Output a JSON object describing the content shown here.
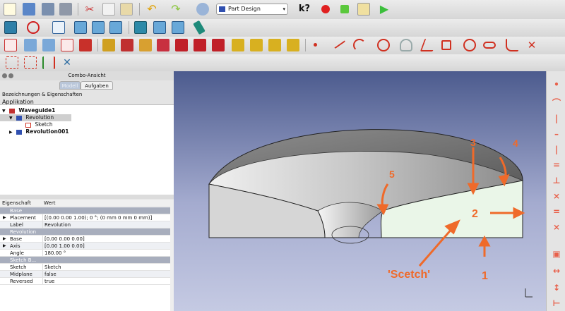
{
  "toolbar": {
    "workbench_label": "Part Design",
    "icons_row1": [
      "new-file",
      "open-file",
      "save-file",
      "save-as",
      "cut",
      "copy",
      "paste",
      "undo",
      "redo",
      "refresh",
      "workbench-selector",
      "whats-this",
      "record-macro",
      "stop-macro",
      "macro-editor",
      "run-macro"
    ],
    "icons_row2": [
      "fit-all",
      "draw-style",
      "axonometric",
      "front",
      "top",
      "right",
      "rear",
      "bottom",
      "left",
      "measure"
    ],
    "icons_row3": [
      "sketch",
      "pad-point",
      "validate",
      "sketch-map",
      "sketch-view",
      "pad",
      "pocket",
      "revolution",
      "groove",
      "fillet",
      "chamfer",
      "draft",
      "mirrored",
      "linear-pattern",
      "polar-pattern",
      "scaled",
      "multi-transform",
      "point",
      "line",
      "arc",
      "circle",
      "conic",
      "polyline",
      "rectangle",
      "polygon",
      "slot",
      "fillet-sketch",
      "trim"
    ],
    "icons_row4": [
      "constraint-coincident",
      "constraint-point-on-object",
      "constraint-vertical",
      "constraint-horizontal"
    ]
  },
  "combo": {
    "title": "Combo-Ansicht",
    "tabs": [
      "Modell",
      "Aufgaben"
    ],
    "tree_header": "Bezeichnungen & Eigenschaften",
    "app_label": "Applikation",
    "tree": [
      {
        "label": "Waveguide1",
        "bold": true
      },
      {
        "label": "Revolution",
        "bold": false
      },
      {
        "label": "Sketch",
        "bold": false
      },
      {
        "label": "Revolution001",
        "bold": true
      }
    ]
  },
  "properties": {
    "col_property": "Eigenschaft",
    "col_value": "Wert",
    "rows": [
      {
        "type": "group",
        "key": "Base"
      },
      {
        "type": "prop",
        "key": "Placement",
        "value": "[(0.00 0.00 1.00); 0 °; (0 mm  0 mm  0 mm)]",
        "expand": true
      },
      {
        "type": "prop",
        "key": "Label",
        "value": "Revolution",
        "expand": false
      },
      {
        "type": "group",
        "key": "Revolution"
      },
      {
        "type": "prop",
        "key": "Base",
        "value": "[0.00 0.00 0.00]",
        "expand": true
      },
      {
        "type": "prop",
        "key": "Axis",
        "value": "[0.00 1.00 0.00]",
        "expand": true
      },
      {
        "type": "prop",
        "key": "Angle",
        "value": "180.00 °",
        "expand": false
      },
      {
        "type": "group",
        "key": "Sketch B..."
      },
      {
        "type": "prop",
        "key": "Sketch",
        "value": "Sketch",
        "expand": false
      },
      {
        "type": "prop",
        "key": "Midplane",
        "value": "false",
        "expand": false
      },
      {
        "type": "prop",
        "key": "Reversed",
        "value": "true",
        "expand": false
      }
    ]
  },
  "annotations": {
    "n1": "1",
    "n2": "2",
    "n3": "3",
    "n4": "4",
    "n5": "5",
    "sketch_label": "'Scetch'",
    "color": "#ef6a2a"
  },
  "viewport": {
    "bg_top": "#4c5b8e",
    "bg_bottom": "#c5cae3",
    "sketch_fill": "#eaf6e8"
  }
}
